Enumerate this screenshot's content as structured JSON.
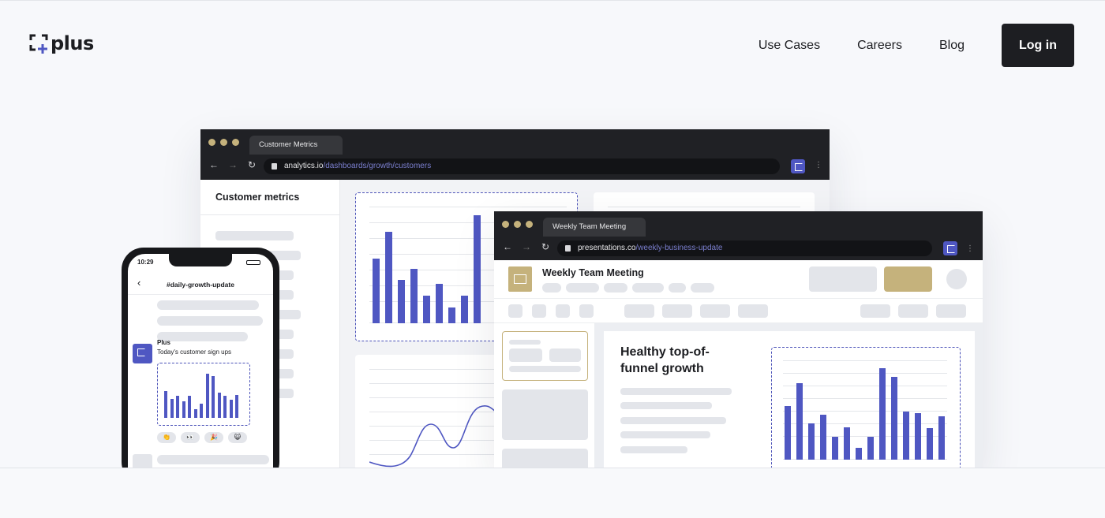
{
  "logo": {
    "word": "plus"
  },
  "nav": {
    "items": [
      "Use Cases",
      "Careers",
      "Blog"
    ],
    "login": "Log in"
  },
  "colors": {
    "accent": "#4f57c2",
    "gold": "#c5b27c",
    "dark": "#1d1e22"
  },
  "analytics_window": {
    "tab": "Customer Metrics",
    "url_host": "analytics.io",
    "url_path": "/dashboards/growth/customers",
    "sidebar_title": "Customer metrics",
    "bar_values": [
      78,
      110,
      52,
      65,
      33,
      47,
      19,
      33,
      130
    ]
  },
  "presentation_window": {
    "tab": "Weekly Team Meeting",
    "url_host": "presentations.co",
    "url_path": "/weekly-business-update",
    "doc_title": "Weekly Team Meeting",
    "slide_heading_line1": "Healthy top-of-",
    "slide_heading_line2": "funnel growth",
    "bar_values": [
      65,
      92,
      44,
      54,
      28,
      39,
      14,
      28,
      110,
      100,
      58,
      56,
      38,
      52
    ]
  },
  "phone": {
    "time": "10:29",
    "channel": "#daily-growth-update",
    "sender": "Plus",
    "message": "Today's customer sign ups",
    "bar_values": [
      32,
      23,
      27,
      20,
      27,
      10,
      17,
      53,
      50,
      30,
      27,
      22,
      28
    ],
    "reactions": [
      "👏",
      "👀",
      "🎉",
      "😺"
    ]
  }
}
